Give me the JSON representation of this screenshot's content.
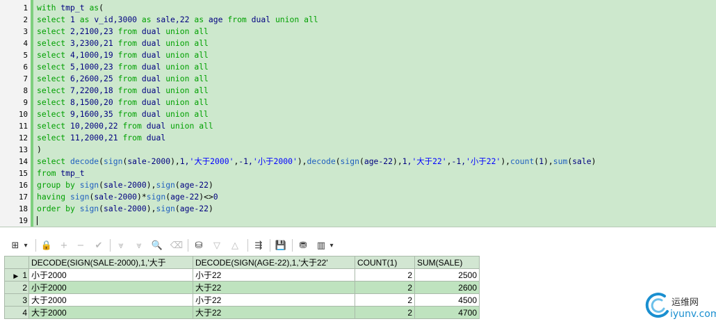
{
  "editor": {
    "lines": [
      {
        "n": "1",
        "tokens": [
          [
            "kw",
            "with "
          ],
          [
            "id",
            "tmp_t "
          ],
          [
            "kw",
            "as"
          ],
          [
            "op",
            "("
          ]
        ]
      },
      {
        "n": "2",
        "tokens": [
          [
            "kw",
            "select "
          ],
          [
            "id",
            "1 "
          ],
          [
            "kw",
            "as "
          ],
          [
            "id",
            "v_id,3000 "
          ],
          [
            "kw",
            "as "
          ],
          [
            "id",
            "sale,22 "
          ],
          [
            "kw",
            "as "
          ],
          [
            "id",
            "age "
          ],
          [
            "kw",
            "from "
          ],
          [
            "id",
            "dual "
          ],
          [
            "kw",
            "union all"
          ]
        ]
      },
      {
        "n": "3",
        "tokens": [
          [
            "kw",
            "select "
          ],
          [
            "id",
            "2,2100,23 "
          ],
          [
            "kw",
            "from "
          ],
          [
            "id",
            "dual "
          ],
          [
            "kw",
            "union all"
          ]
        ]
      },
      {
        "n": "4",
        "tokens": [
          [
            "kw",
            "select "
          ],
          [
            "id",
            "3,2300,21 "
          ],
          [
            "kw",
            "from "
          ],
          [
            "id",
            "dual "
          ],
          [
            "kw",
            "union all"
          ]
        ]
      },
      {
        "n": "5",
        "tokens": [
          [
            "kw",
            "select "
          ],
          [
            "id",
            "4,1000,19 "
          ],
          [
            "kw",
            "from "
          ],
          [
            "id",
            "dual "
          ],
          [
            "kw",
            "union all"
          ]
        ]
      },
      {
        "n": "6",
        "tokens": [
          [
            "kw",
            "select "
          ],
          [
            "id",
            "5,1000,23 "
          ],
          [
            "kw",
            "from "
          ],
          [
            "id",
            "dual "
          ],
          [
            "kw",
            "union all"
          ]
        ]
      },
      {
        "n": "7",
        "tokens": [
          [
            "kw",
            "select "
          ],
          [
            "id",
            "6,2600,25 "
          ],
          [
            "kw",
            "from "
          ],
          [
            "id",
            "dual "
          ],
          [
            "kw",
            "union all"
          ]
        ]
      },
      {
        "n": "8",
        "tokens": [
          [
            "kw",
            "select "
          ],
          [
            "id",
            "7,2200,18 "
          ],
          [
            "kw",
            "from "
          ],
          [
            "id",
            "dual "
          ],
          [
            "kw",
            "union all"
          ]
        ]
      },
      {
        "n": "9",
        "tokens": [
          [
            "kw",
            "select "
          ],
          [
            "id",
            "8,1500,20 "
          ],
          [
            "kw",
            "from "
          ],
          [
            "id",
            "dual "
          ],
          [
            "kw",
            "union all"
          ]
        ]
      },
      {
        "n": "10",
        "tokens": [
          [
            "kw",
            "select "
          ],
          [
            "id",
            "9,1600,35 "
          ],
          [
            "kw",
            "from "
          ],
          [
            "id",
            "dual "
          ],
          [
            "kw",
            "union all"
          ]
        ]
      },
      {
        "n": "11",
        "tokens": [
          [
            "kw",
            "select "
          ],
          [
            "id",
            "10,2000,22 "
          ],
          [
            "kw",
            "from "
          ],
          [
            "id",
            "dual "
          ],
          [
            "kw",
            "union all"
          ]
        ]
      },
      {
        "n": "12",
        "tokens": [
          [
            "kw",
            "select "
          ],
          [
            "id",
            "11,2000,21 "
          ],
          [
            "kw",
            "from "
          ],
          [
            "id",
            "dual"
          ]
        ]
      },
      {
        "n": "13",
        "tokens": [
          [
            "op",
            ")"
          ]
        ]
      },
      {
        "n": "14",
        "tokens": [
          [
            "kw",
            "select "
          ],
          [
            "fn",
            "decode"
          ],
          [
            "op",
            "("
          ],
          [
            "fn",
            "sign"
          ],
          [
            "op",
            "("
          ],
          [
            "id",
            "sale-2000"
          ],
          [
            "op",
            "),"
          ],
          [
            "id",
            "1,"
          ],
          [
            "st",
            "'大于2000'"
          ],
          [
            "op",
            ","
          ],
          [
            "id",
            "-1,"
          ],
          [
            "st",
            "'小于2000'"
          ],
          [
            "op",
            "),"
          ],
          [
            "fn",
            "decode"
          ],
          [
            "op",
            "("
          ],
          [
            "fn",
            "sign"
          ],
          [
            "op",
            "("
          ],
          [
            "id",
            "age-22"
          ],
          [
            "op",
            "),"
          ],
          [
            "id",
            "1,"
          ],
          [
            "st",
            "'大于22'"
          ],
          [
            "op",
            ","
          ],
          [
            "id",
            "-1,"
          ],
          [
            "st",
            "'小于22'"
          ],
          [
            "op",
            "),"
          ],
          [
            "fn",
            "count"
          ],
          [
            "op",
            "("
          ],
          [
            "id",
            "1"
          ],
          [
            "op",
            "),"
          ],
          [
            "fn",
            "sum"
          ],
          [
            "op",
            "("
          ],
          [
            "id",
            "sale"
          ],
          [
            "op",
            ")"
          ]
        ]
      },
      {
        "n": "15",
        "tokens": [
          [
            "kw",
            "from "
          ],
          [
            "id",
            "tmp_t"
          ]
        ]
      },
      {
        "n": "16",
        "tokens": [
          [
            "kw",
            "group by "
          ],
          [
            "fn",
            "sign"
          ],
          [
            "op",
            "("
          ],
          [
            "id",
            "sale-2000"
          ],
          [
            "op",
            "),"
          ],
          [
            "fn",
            "sign"
          ],
          [
            "op",
            "("
          ],
          [
            "id",
            "age-22"
          ],
          [
            "op",
            ")"
          ]
        ]
      },
      {
        "n": "17",
        "tokens": [
          [
            "kw",
            "having "
          ],
          [
            "fn",
            "sign"
          ],
          [
            "op",
            "("
          ],
          [
            "id",
            "sale-2000"
          ],
          [
            "op",
            ")*"
          ],
          [
            "fn",
            "sign"
          ],
          [
            "op",
            "("
          ],
          [
            "id",
            "age-22"
          ],
          [
            "op",
            ")<>"
          ],
          [
            "id",
            "0"
          ]
        ]
      },
      {
        "n": "18",
        "tokens": [
          [
            "kw",
            "order by "
          ],
          [
            "fn",
            "sign"
          ],
          [
            "op",
            "("
          ],
          [
            "id",
            "sale-2000"
          ],
          [
            "op",
            "),"
          ],
          [
            "fn",
            "sign"
          ],
          [
            "op",
            "("
          ],
          [
            "id",
            "age-22"
          ],
          [
            "op",
            ")"
          ]
        ]
      },
      {
        "n": "19",
        "tokens": []
      }
    ]
  },
  "toolbar": {
    "icons": [
      {
        "name": "grid-view-icon",
        "glyph": "⊞",
        "enabled": true
      },
      {
        "name": "dropdown-arrow-icon",
        "glyph": "▾",
        "enabled": true
      },
      {
        "name": "lock-icon",
        "glyph": "🔒",
        "enabled": true
      },
      {
        "name": "add-record-icon",
        "glyph": "+",
        "enabled": false
      },
      {
        "name": "delete-record-icon",
        "glyph": "−",
        "enabled": false
      },
      {
        "name": "post-changes-icon",
        "glyph": "✔",
        "enabled": false
      },
      {
        "name": "fetch-next-icon",
        "glyph": "⩔",
        "enabled": false
      },
      {
        "name": "fetch-last-icon",
        "glyph": "⩔",
        "enabled": false
      },
      {
        "name": "find-icon",
        "glyph": "🔍",
        "enabled": true
      },
      {
        "name": "clear-icon",
        "glyph": "⌫",
        "enabled": false
      },
      {
        "name": "query-by-example-icon",
        "glyph": "⛁",
        "enabled": true
      },
      {
        "name": "filter-icon",
        "glyph": "▽",
        "enabled": false
      },
      {
        "name": "sort-icon",
        "glyph": "△",
        "enabled": false
      },
      {
        "name": "export-tree-icon",
        "glyph": "⇶",
        "enabled": true
      },
      {
        "name": "save-icon",
        "glyph": "💾",
        "enabled": true
      },
      {
        "name": "database-icon",
        "glyph": "⛃",
        "enabled": true
      },
      {
        "name": "chart-icon",
        "glyph": "▥",
        "enabled": true
      },
      {
        "name": "chart-dropdown-icon",
        "glyph": "▾",
        "enabled": true
      }
    ]
  },
  "results": {
    "columns": [
      "DECODE(SIGN(SALE-2000),1,'大于",
      "DECODE(SIGN(AGE-22),1,'大于22'",
      "COUNT(1)",
      "SUM(SALE)"
    ],
    "rows": [
      {
        "n": "1",
        "c1": "小于2000",
        "c2": "小于22",
        "c3": "2",
        "c4": "2500"
      },
      {
        "n": "2",
        "c1": "小于2000",
        "c2": "大于22",
        "c3": "2",
        "c4": "2600"
      },
      {
        "n": "3",
        "c1": "大于2000",
        "c2": "小于22",
        "c3": "2",
        "c4": "4500"
      },
      {
        "n": "4",
        "c1": "大于2000",
        "c2": "大于22",
        "c3": "2",
        "c4": "4700"
      }
    ]
  },
  "watermark": {
    "line1": "运维网",
    "line2": "iyunv.com"
  }
}
